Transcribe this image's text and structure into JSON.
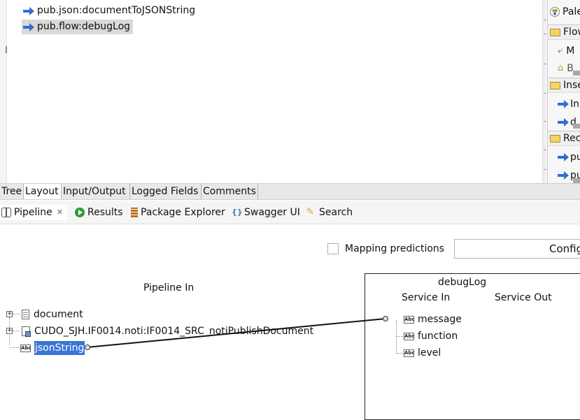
{
  "editor": {
    "steps": [
      {
        "label": "pub.json:documentToJSONString",
        "selected": false
      },
      {
        "label": "pub.flow:debugLog",
        "selected": true
      }
    ]
  },
  "palette": {
    "header": "Pale",
    "rows": [
      {
        "kind": "folder",
        "label": "Flow"
      },
      {
        "kind": "item",
        "label": "M"
      },
      {
        "kind": "item",
        "label": "B"
      },
      {
        "kind": "folder",
        "label": "Inse"
      },
      {
        "kind": "item",
        "label": "In"
      },
      {
        "kind": "item",
        "label": "d"
      },
      {
        "kind": "folder",
        "label": "Rec"
      },
      {
        "kind": "item",
        "label": "pu"
      },
      {
        "kind": "item",
        "label": "pu"
      }
    ]
  },
  "view_tabs": [
    "Tree",
    "Layout",
    "Input/Output",
    "Logged Fields",
    "Comments"
  ],
  "active_view_tab": "Layout",
  "panel_tabs": [
    {
      "label": "Pipeline",
      "icon": "pipeline-icon",
      "active": true
    },
    {
      "label": "Results",
      "icon": "results-icon"
    },
    {
      "label": "Package Explorer",
      "icon": "package-explorer-icon"
    },
    {
      "label": "Swagger UI",
      "icon": "swagger-icon"
    },
    {
      "label": "Search",
      "icon": "search-icon"
    }
  ],
  "pipeline": {
    "mapping_predictions_label": "Mapping predictions",
    "mapping_predictions_checked": false,
    "config_button_label": "Config",
    "pipeline_in": {
      "title": "Pipeline In",
      "fields": [
        {
          "label": "document",
          "type": "document",
          "expandable": true
        },
        {
          "label": "CUDO_SJH.IF0014.noti:IF0014_SRC_notiPublishDocument",
          "type": "document-reference",
          "expandable": true
        },
        {
          "label": "jsonString",
          "type": "string",
          "selected": true
        }
      ]
    },
    "service": {
      "name": "debugLog",
      "service_in_label": "Service In",
      "service_out_label": "Service Out",
      "inputs": [
        {
          "label": "message",
          "type": "string"
        },
        {
          "label": "function",
          "type": "string"
        },
        {
          "label": "level",
          "type": "string"
        }
      ]
    },
    "links": [
      {
        "from": "jsonString",
        "to": "message"
      }
    ],
    "string_icon_text": "Abc"
  }
}
